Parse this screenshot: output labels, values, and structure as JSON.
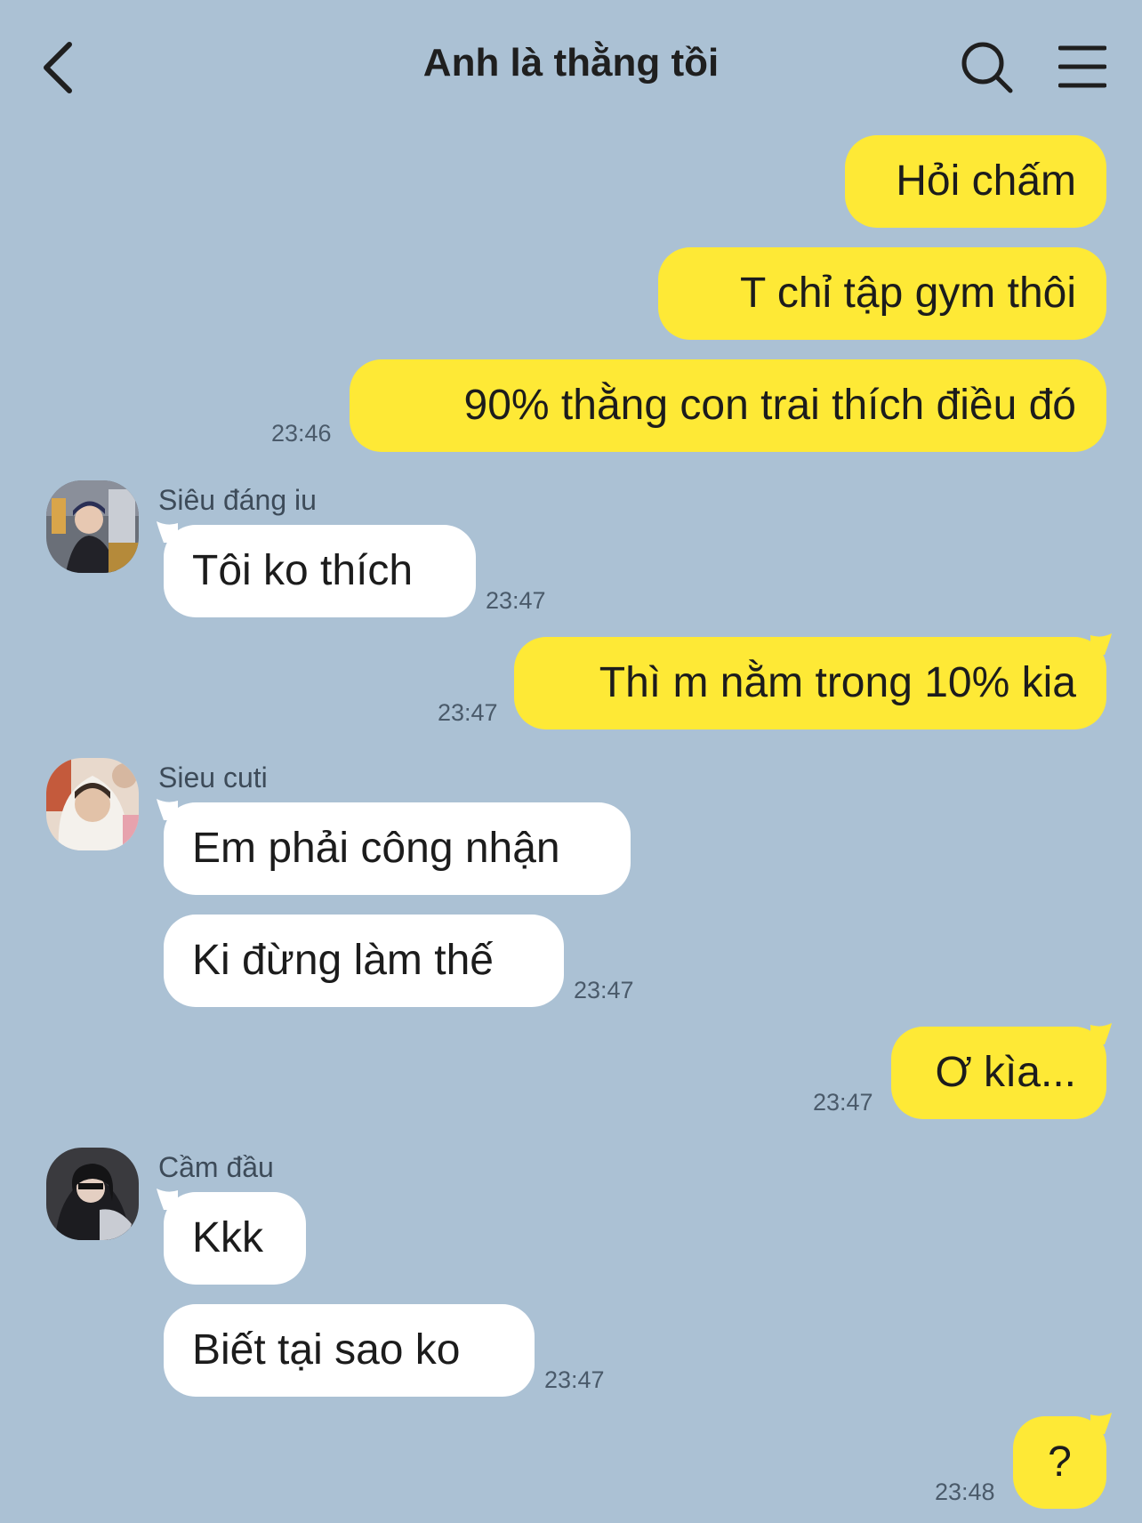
{
  "header": {
    "title": "Anh là thằng tồi",
    "back_icon": "chevron-left-icon",
    "search_icon": "search-icon",
    "menu_icon": "menu-icon"
  },
  "colors": {
    "background": "#abc1d4",
    "outgoing_bubble": "#fee936",
    "incoming_bubble": "#ffffff"
  },
  "messages": {
    "m1": {
      "text": "Hỏi chấm"
    },
    "m2": {
      "text": "T chỉ tập gym thôi"
    },
    "m3": {
      "text": "90% thằng con trai thích điều đó",
      "time": "23:46"
    },
    "g1": {
      "sender": "Siêu đáng iu",
      "text": "Tôi ko thích",
      "time": "23:47"
    },
    "m4": {
      "text": "Thì m nằm trong 10% kia",
      "time": "23:47"
    },
    "g2": {
      "sender": "Sieu cuti",
      "text1": "Em phải công nhận",
      "text2": "Ki đừng làm thế",
      "time": "23:47"
    },
    "m5": {
      "text": "Ơ kìa...",
      "time": "23:47"
    },
    "g3": {
      "sender": "Cầm đầu",
      "text1": "Kkk",
      "text2": "Biết tại sao ko",
      "time": "23:47"
    },
    "m6": {
      "text": "?",
      "time": "23:48"
    }
  }
}
